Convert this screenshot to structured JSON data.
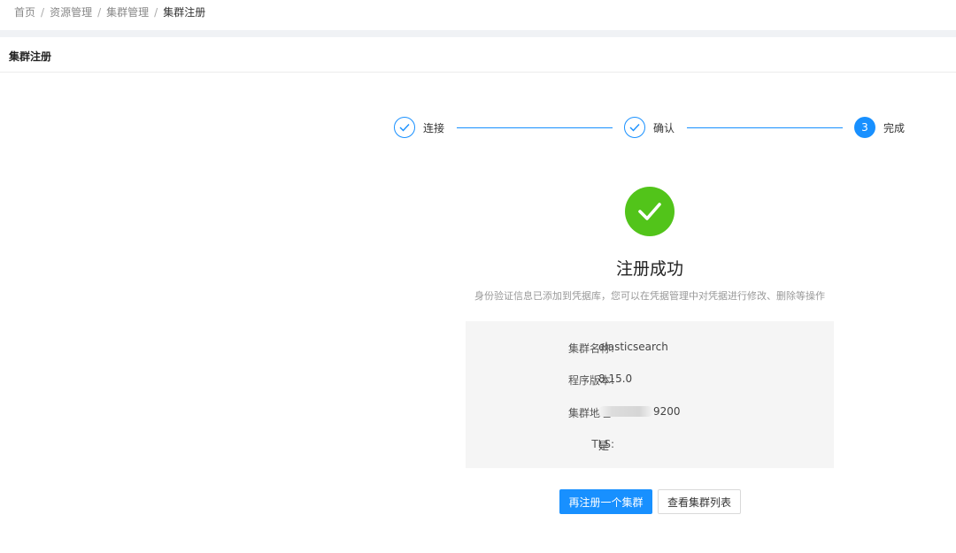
{
  "breadcrumb": {
    "items": [
      "首页",
      "资源管理",
      "集群管理",
      "集群注册"
    ],
    "separator": "/"
  },
  "page": {
    "title": "集群注册"
  },
  "steps": [
    {
      "label": "连接",
      "status": "done"
    },
    {
      "label": "确认",
      "status": "done"
    },
    {
      "label": "完成",
      "status": "active",
      "number": "3"
    }
  ],
  "result": {
    "title": "注册成功",
    "subtitle": "身份验证信息已添加到凭据库，您可以在凭据管理中对凭据进行修改、删除等操作",
    "icon": "check-circle-icon"
  },
  "info": [
    {
      "key": "集群名称:",
      "value": "elasticsearch"
    },
    {
      "key": "程序版本:",
      "value": "8.15.0"
    },
    {
      "key": "集群地址:",
      "value": "9200",
      "masked": true
    },
    {
      "key": "TLS:",
      "value": "是"
    }
  ],
  "actions": {
    "register_another": "再注册一个集群",
    "view_list": "查看集群列表"
  },
  "colors": {
    "primary": "#1890ff",
    "success": "#52c41a"
  }
}
